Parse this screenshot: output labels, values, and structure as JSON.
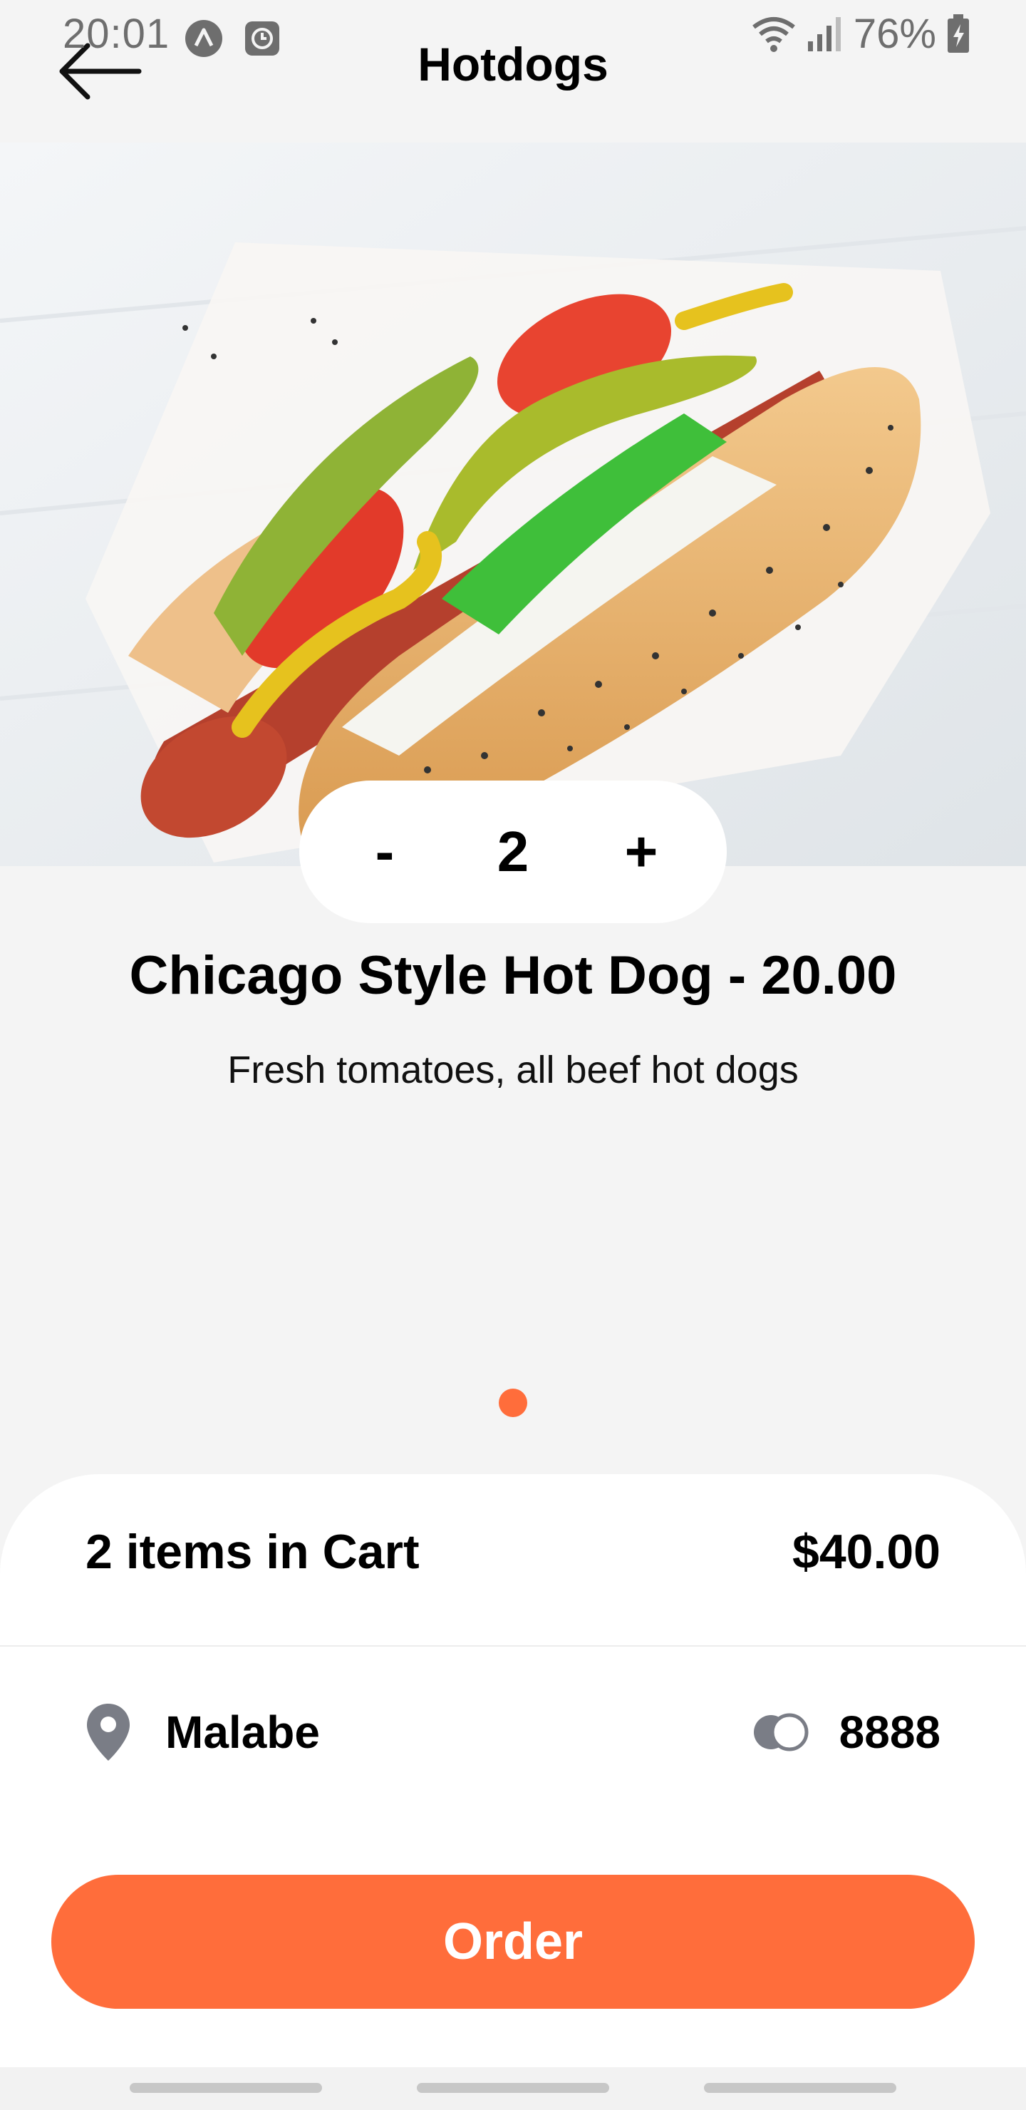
{
  "status_bar": {
    "time": "20:01",
    "battery": "76%",
    "icons": [
      "navigation-app-icon",
      "clock-app-icon",
      "wifi-icon",
      "signal-icon",
      "battery-charging-icon"
    ]
  },
  "header": {
    "title": "Hotdogs",
    "back_icon": "arrow-left-icon"
  },
  "product": {
    "image_alt": "hot-dog-photo",
    "quantity": "2",
    "decrement_label": "-",
    "increment_label": "+",
    "name": "Chicago Style Hot Dog - 20.00",
    "description": "Fresh tomatoes, all beef hot dogs"
  },
  "pager": {
    "active_color": "#ff6d3b"
  },
  "cart": {
    "items_label": "2 items in Cart",
    "total": "$40.00",
    "location": "Malabe",
    "location_icon": "map-pin-icon",
    "points": "8888",
    "points_icon": "coins-icon",
    "order_label": "Order"
  },
  "colors": {
    "accent": "#ff6d3b",
    "background": "#f4f4f4",
    "card": "#ffffff"
  }
}
